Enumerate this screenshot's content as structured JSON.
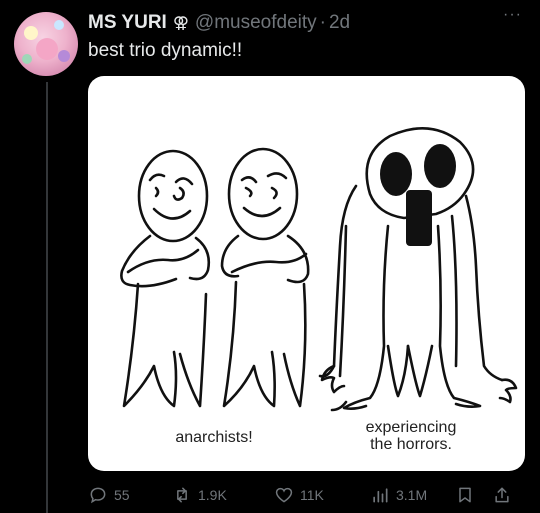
{
  "tweet": {
    "display_name": "MS YURI",
    "symbol": "⚢",
    "handle": "@museofdeity",
    "separator": "·",
    "time": "2d",
    "more": "···",
    "text": "best trio dynamic!!"
  },
  "media": {
    "caption_left": "anarchists!",
    "caption_right_line1": "experiencing",
    "caption_right_line2": "the horrors."
  },
  "actions": {
    "replies": "55",
    "reposts": "1.9K",
    "likes": "11K",
    "views": "3.1M"
  },
  "icons": [
    "reply-icon",
    "repost-icon",
    "like-icon",
    "views-icon",
    "bookmark-icon",
    "share-icon",
    "more-icon"
  ]
}
